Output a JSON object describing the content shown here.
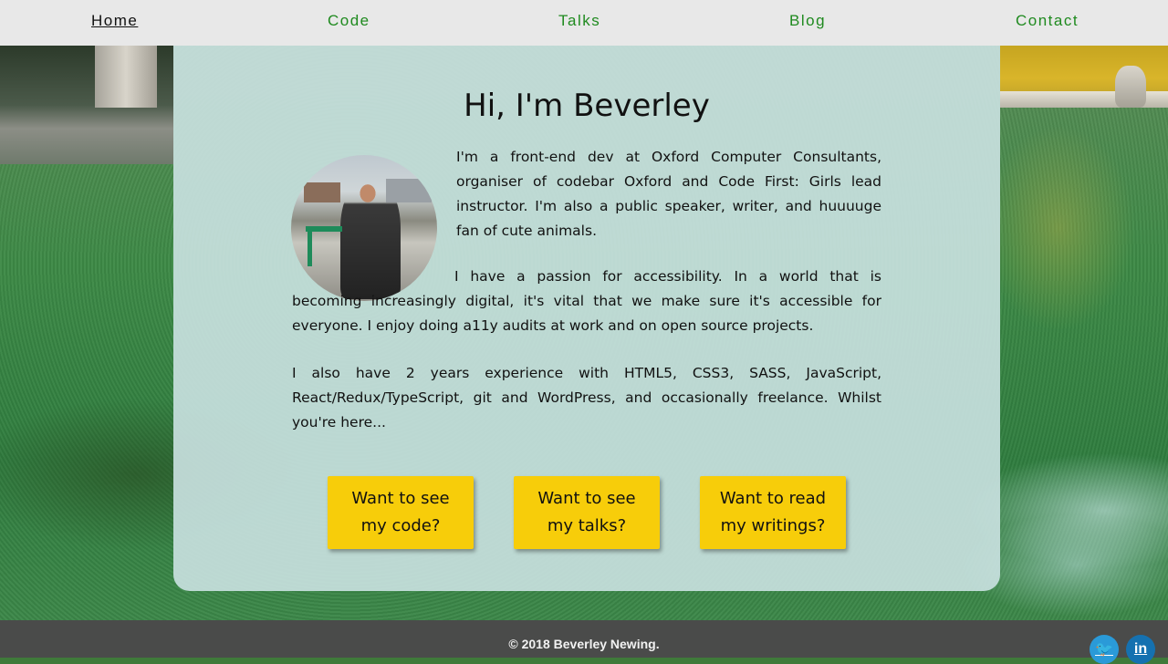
{
  "nav": {
    "items": [
      "Home",
      "Code",
      "Talks",
      "Blog",
      "Contact"
    ],
    "active": "Home"
  },
  "main": {
    "title": "Hi, I'm Beverley",
    "paragraph1": "I'm a front-end dev at Oxford Computer Consultants, organiser of codebar Oxford and Code First: Girls lead instructor. I'm also a public speaker, writer, and huuuuge fan of cute animals.",
    "paragraph2": "I have a passion for accessibility. In a world that is becoming increasingly digital, it's vital that we make sure it's accessible for everyone. I enjoy doing a11y audits at work and on open source projects.",
    "paragraph3": "I also have 2 years experience with HTML5, CSS3, SASS, JavaScript, React/Redux/TypeScript, git and WordPress, and occasionally freelance. Whilst you're here...",
    "buttons": [
      "Want to see my code?",
      "Want to see my talks?",
      "Want to read my writings?"
    ]
  },
  "footer": {
    "copyright": "© 2018 Beverley Newing.",
    "social": [
      {
        "name": "twitter-icon",
        "glyph": "🐦"
      },
      {
        "name": "linkedin-icon",
        "glyph": "in"
      }
    ]
  },
  "colors": {
    "nav_link": "#1f8a1f",
    "button_bg": "#f7cd0a",
    "footer_bg": "#4a4b4a"
  }
}
